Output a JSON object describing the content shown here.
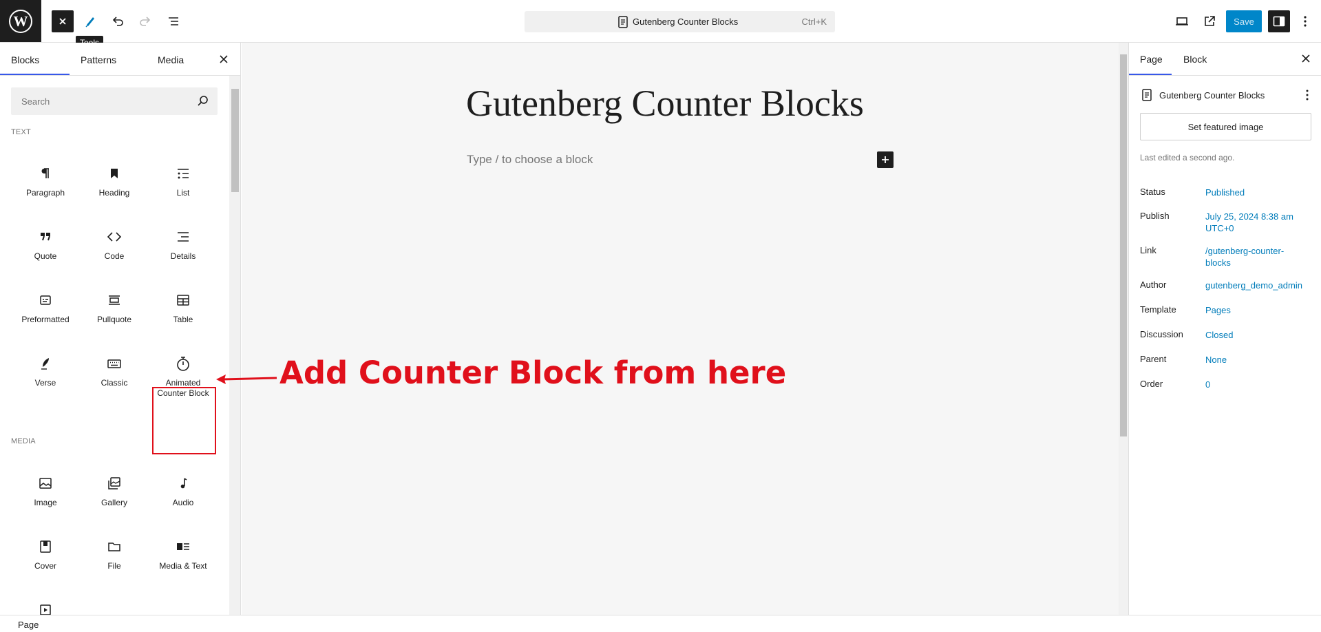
{
  "topbar": {
    "tooltip": "Tools",
    "command_bar_title": "Gutenberg Counter Blocks",
    "command_bar_shortcut": "Ctrl+K",
    "save_label": "Save",
    "accent_color": "#0086c9"
  },
  "inserter": {
    "tabs": [
      {
        "label": "Blocks",
        "active": true
      },
      {
        "label": "Patterns",
        "active": false
      },
      {
        "label": "Media",
        "active": false
      }
    ],
    "search_placeholder": "Search",
    "categories": [
      {
        "label": "TEXT",
        "blocks": [
          {
            "label": "Paragraph",
            "icon": "paragraph-icon"
          },
          {
            "label": "Heading",
            "icon": "heading-icon"
          },
          {
            "label": "List",
            "icon": "list-icon"
          },
          {
            "label": "Quote",
            "icon": "quote-icon"
          },
          {
            "label": "Code",
            "icon": "code-icon"
          },
          {
            "label": "Details",
            "icon": "details-icon"
          },
          {
            "label": "Preformatted",
            "icon": "preformatted-icon"
          },
          {
            "label": "Pullquote",
            "icon": "pullquote-icon"
          },
          {
            "label": "Table",
            "icon": "table-icon"
          },
          {
            "label": "Verse",
            "icon": "verse-icon"
          },
          {
            "label": "Classic",
            "icon": "classic-icon"
          },
          {
            "label": "Animated Counter Block",
            "icon": "stopwatch-icon"
          }
        ]
      },
      {
        "label": "MEDIA",
        "blocks": [
          {
            "label": "Image",
            "icon": "image-icon"
          },
          {
            "label": "Gallery",
            "icon": "gallery-icon"
          },
          {
            "label": "Audio",
            "icon": "audio-icon"
          },
          {
            "label": "Cover",
            "icon": "cover-icon"
          },
          {
            "label": "File",
            "icon": "file-icon"
          },
          {
            "label": "Media & Text",
            "icon": "media-text-icon"
          }
        ]
      }
    ]
  },
  "canvas": {
    "title": "Gutenberg Counter Blocks",
    "placeholder": "Type / to choose a block",
    "annotation": "Add Counter Block from here",
    "annotation_color": "#e0101b"
  },
  "settings": {
    "tabs": [
      {
        "label": "Page",
        "active": true
      },
      {
        "label": "Block",
        "active": false
      }
    ],
    "doc_title": "Gutenberg Counter Blocks",
    "featured_image_label": "Set featured image",
    "last_edited": "Last edited a second ago.",
    "meta": [
      {
        "label": "Status",
        "value": "Published"
      },
      {
        "label": "Publish",
        "value": "July 25, 2024 8:38 am UTC+0"
      },
      {
        "label": "Link",
        "value": "/gutenberg-counter-blocks"
      },
      {
        "label": "Author",
        "value": "gutenberg_demo_admin"
      },
      {
        "label": "Template",
        "value": "Pages"
      },
      {
        "label": "Discussion",
        "value": "Closed"
      },
      {
        "label": "Parent",
        "value": "None"
      },
      {
        "label": "Order",
        "value": "0"
      }
    ]
  },
  "footer": {
    "breadcrumb": "Page"
  }
}
